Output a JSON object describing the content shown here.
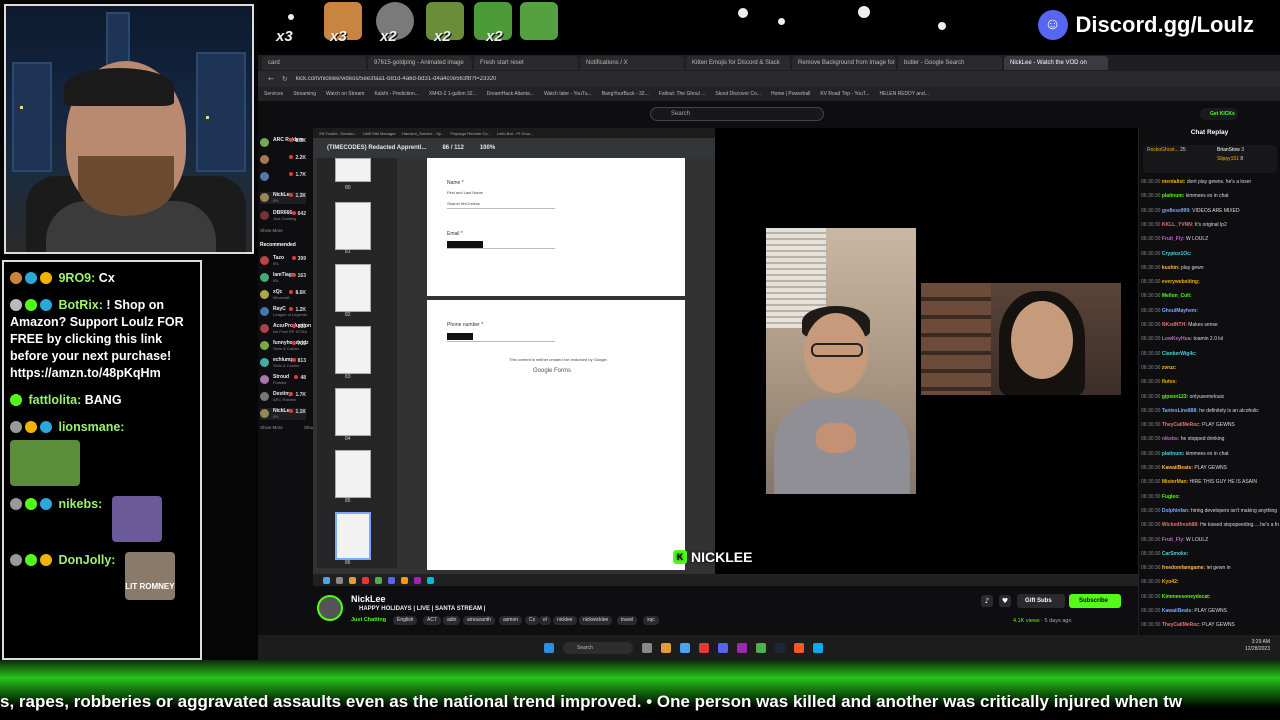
{
  "topbar": {
    "emote_counts": [
      "x3",
      "x3",
      "x2",
      "x2",
      "x2"
    ],
    "discord_text": "Discord.gg/Loulz"
  },
  "chat": {
    "messages": [
      {
        "user": "9RO9:",
        "text": "Cx"
      },
      {
        "user": "BotRix:",
        "text": "! Shop on Amazon? Support Loulz FOR FREE by clicking this link before your next purchase! https://amzn.to/48pKqHm"
      },
      {
        "user": "fattlolita:",
        "text": "BANG"
      },
      {
        "user": "lionsmane:",
        "text": ""
      },
      {
        "user": "nikebs:",
        "text": ""
      },
      {
        "user": "DonJolly:",
        "text": ""
      }
    ],
    "emote_label": "LIT ROMNEY"
  },
  "browser": {
    "tabs": [
      "card",
      "97615-goldping - Animated image",
      "Fresh start reset",
      "Notifications / X",
      "Kitten Emojis for Discord & Slack",
      "Remove Background from Image for",
      "butler - Google Search",
      "NickLee - Watch the VOD on"
    ],
    "url": "kick.com/nicklee/videos/5ee3faa1-b81d-4a6d-bd31-d4a4c0e563fb?t=23320",
    "bookmarks": [
      "Services",
      "Streaming",
      "Watch on Stream",
      "Kalshi - Prediction...",
      "XM43-2 1-gallon 32...",
      "DreamHack Atlanta...",
      "Watch later - YouTu...",
      "BangYourBuck - 32...",
      "Fallout: The Ghoul ...",
      "Skoot Discover Co...",
      "Home | Powerball",
      "KV Road Trip - YouT...",
      "HELEN REDDY and..."
    ],
    "search_placeholder": "Search",
    "get_kicks": "Get KICKs"
  },
  "sidebar": {
    "following": [
      {
        "name": "ARC Raiders",
        "sub": "",
        "viewers": "8.5K"
      },
      {
        "name": "",
        "sub": "",
        "viewers": "2.2K"
      },
      {
        "name": "",
        "sub": "",
        "viewers": "1.7K"
      },
      {
        "name": "NickLee",
        "sub": "IRL",
        "viewers": "1.3K"
      },
      {
        "name": "DBR666",
        "sub": "Just Chatting",
        "viewers": "642"
      }
    ],
    "show_more": "Show More",
    "recommended_label": "Recommended",
    "recommended": [
      {
        "name": "Tazo",
        "sub": "IRL",
        "viewers": "399"
      },
      {
        "name": "lamTiagz",
        "sub": "IRL",
        "viewers": "163"
      },
      {
        "name": "xQc",
        "sub": "Minecraft",
        "viewers": "8.6K"
      },
      {
        "name": "RayC",
        "sub": "League of Legends",
        "viewers": "1.2K"
      },
      {
        "name": "AcezProduction",
        "sub": "No Pixel RP IGTA5",
        "viewers": "350"
      },
      {
        "name": "funnyhoodvidz",
        "sub": "Slots & Casino",
        "viewers": "735"
      },
      {
        "name": "echlump",
        "sub": "Slots & Casino",
        "viewers": "813"
      },
      {
        "name": "Stroud",
        "sub": "Fortnite",
        "viewers": "48"
      },
      {
        "name": "Destiny",
        "sub": "ARC Raiders",
        "viewers": "1.7K"
      },
      {
        "name": "NickLee",
        "sub": "IRL",
        "viewers": "1.1K"
      }
    ],
    "show_less": "Show Less"
  },
  "pdf": {
    "tabs": [
      "XN Toolkit - Decisio...",
      "Unifi Site Manager",
      "Harrison_Service - Sp...",
      "Poynago Remote Co...",
      "Lotto Bot - PI Grou..."
    ],
    "title": "(TIMECODES) Redacted Apprenti...",
    "page": "86",
    "total": "/ 112",
    "zoom": "100%",
    "thumb_labels": [
      "80",
      "81",
      "82",
      "83",
      "84",
      "85",
      "86"
    ],
    "name_label": "Name *",
    "name_hint": "First and Last Name",
    "name_value": "Sharon McCreless",
    "email_label": "Email *",
    "phone_label": "Phone number *",
    "forms_note": "This content is neither created nor endorsed by Google.",
    "google_forms": "Google Forms"
  },
  "stream": {
    "overlay_name": "NICKLEE",
    "channel_name": "NickLee",
    "title": "HAPPY HOLIDAYS | LIVE | SANTA STREAM |",
    "category": "Just Chatting",
    "tags": [
      "English",
      "AC7",
      "adin",
      "amouranth",
      "asmon",
      "Cx",
      "el",
      "nicklee",
      "nickwicklee",
      "travel",
      "xqc"
    ],
    "gift_subs": "Gift Subs",
    "subscribe": "Subscribe",
    "views": "4.1K views",
    "ago": "5 days ago"
  },
  "replay": {
    "header": "Chat Replay",
    "pinned": [
      {
        "user": "RockoGhost...",
        "count": "25"
      },
      {
        "user": "BrianStow",
        "count": "3"
      },
      {
        "user": "Slippy151",
        "count": "8"
      }
    ],
    "lines": [
      {
        "t": "06:30:30",
        "u": "mentalist:",
        "m": "dont play gewns. he's a loser"
      },
      {
        "t": "06:30:30",
        "u": "platinum:",
        "m": "kimmees ex in chat"
      },
      {
        "t": "06:30:30",
        "u": "godless999:",
        "m": "VIDEOS ARE MIXED"
      },
      {
        "t": "06:30:30",
        "u": "KKLL_YVNN:",
        "m": "It's original lp2"
      },
      {
        "t": "06:30:30",
        "u": "Fruit_Fly:",
        "m": "W LOULZ"
      },
      {
        "t": "06:30:30",
        "u": "Cryptoz1Oc:",
        "m": ""
      },
      {
        "t": "06:30:30",
        "u": "kushin:",
        "m": "play gewn"
      },
      {
        "t": "06:30:30",
        "u": "everywebsiting:",
        "m": ""
      },
      {
        "t": "06:30:30",
        "u": "Mellon_Coli:",
        "m": ""
      },
      {
        "t": "06:30:30",
        "u": "GhoulMayhem:",
        "m": ""
      },
      {
        "t": "06:30:30",
        "u": "NKsdNTH:",
        "m": "Makes sense"
      },
      {
        "t": "06:30:30",
        "u": "LowKeyHua:",
        "m": "toamin 2.0 lol"
      },
      {
        "t": "06:30:30",
        "u": "ClankerWig4c:",
        "m": ""
      },
      {
        "t": "06:30:30",
        "u": "zvruz:",
        "m": ""
      },
      {
        "t": "06:30:30",
        "u": "flutvs:",
        "m": ""
      },
      {
        "t": "06:30:30",
        "u": "gipson123:",
        "m": "onlyusemelouiz"
      },
      {
        "t": "06:30:30",
        "u": "TantesLine888:",
        "m": "he definitely is an alcoholic"
      },
      {
        "t": "06:30:30",
        "u": "TheyCallMeRoc:",
        "m": "PLAY GEWNS"
      },
      {
        "t": "06:30:30",
        "u": "nikebs:",
        "m": "he stopped drinking"
      },
      {
        "t": "06:30:30",
        "u": "platinum:",
        "m": "kimmees ex in chat"
      },
      {
        "t": "06:30:30",
        "u": "KawaiiBeats:",
        "m": "PLAY GEWNS"
      },
      {
        "t": "06:30:30",
        "u": "MisterMan:",
        "m": "HIRE THIS GUY HE IS ASAIN"
      },
      {
        "t": "06:30:30",
        "u": "Fugleo:",
        "m": ""
      },
      {
        "t": "06:30:30",
        "u": "Dolphinfan:",
        "m": "hiring developers isn't making anything"
      },
      {
        "t": "06:30:30",
        "u": "Wickedfresh88:",
        "m": "He kissed stopspeeding.....he's a frontrunner"
      },
      {
        "t": "06:30:30",
        "u": "Fruit_Fly:",
        "m": "W LOULZ"
      },
      {
        "t": "06:30:30",
        "u": "CarSmoke:",
        "m": ""
      },
      {
        "t": "06:30:30",
        "u": "freedomfamgame:",
        "m": "let gewn in"
      },
      {
        "t": "06:30:30",
        "u": "Kyo42:",
        "m": ""
      },
      {
        "t": "06:30:30",
        "u": "Kimmeesoneydecat:",
        "m": ""
      },
      {
        "t": "06:30:30",
        "u": "KawaiiBeats:",
        "m": "PLAY GEWNS"
      },
      {
        "t": "06:30:30",
        "u": "TheyCallMeRoc:",
        "m": "PLAY GEWNS"
      }
    ]
  },
  "taskbar": {
    "search": "Search",
    "time": "3:29 AM",
    "date": "12/28/2023"
  },
  "ticker": {
    "text": "s, rapes, robberies or aggravated assaults even as the national trend improved.   •   One person was killed and another was critically injured when tw"
  },
  "colors": {
    "kick_green": "#53fc18",
    "discord_blurple": "#5865f2",
    "live_red": "#e53935"
  }
}
